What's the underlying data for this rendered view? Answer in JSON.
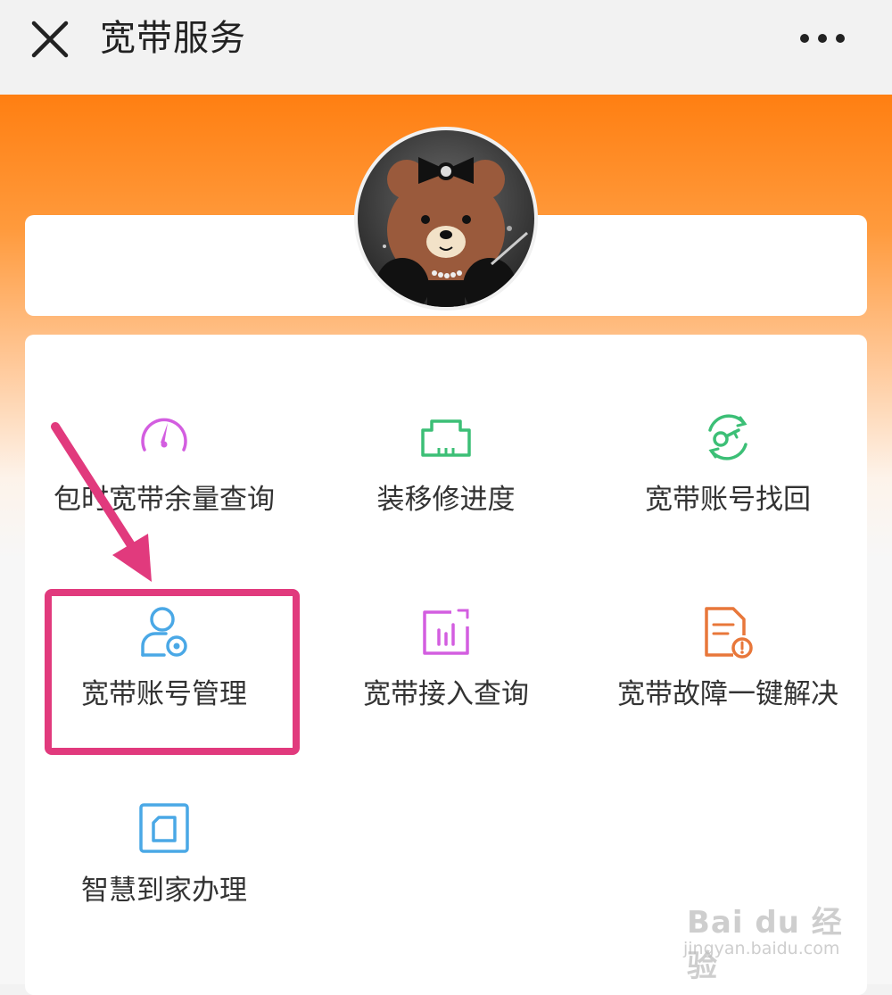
{
  "header": {
    "title": "宽带服务",
    "close_icon": "close-icon",
    "more_icon": "more-dots-icon"
  },
  "profile": {
    "avatar_icon": "bear-avatar"
  },
  "menu": {
    "items": [
      {
        "label": "包时宽带余量查询",
        "icon": "speedometer-icon",
        "color": "#d35ee0"
      },
      {
        "label": "装移修进度",
        "icon": "ethernet-port-icon",
        "color": "#3cbf76"
      },
      {
        "label": "宽带账号找回",
        "icon": "key-refresh-icon",
        "color": "#3cbf76"
      },
      {
        "label": "宽带账号管理",
        "icon": "user-settings-icon",
        "color": "#4aa8e6"
      },
      {
        "label": "宽带接入查询",
        "icon": "bar-chart-icon",
        "color": "#d35ee0"
      },
      {
        "label": "宽带故障一键解决",
        "icon": "document-warning-icon",
        "color": "#e8773a"
      },
      {
        "label": "智慧到家办理",
        "icon": "home-box-icon",
        "color": "#4aa8e6"
      }
    ]
  },
  "annotation": {
    "highlight_color": "#e13a7d"
  },
  "watermark": {
    "main": "Bai du 经验",
    "sub": "jingyan.baidu.com"
  }
}
